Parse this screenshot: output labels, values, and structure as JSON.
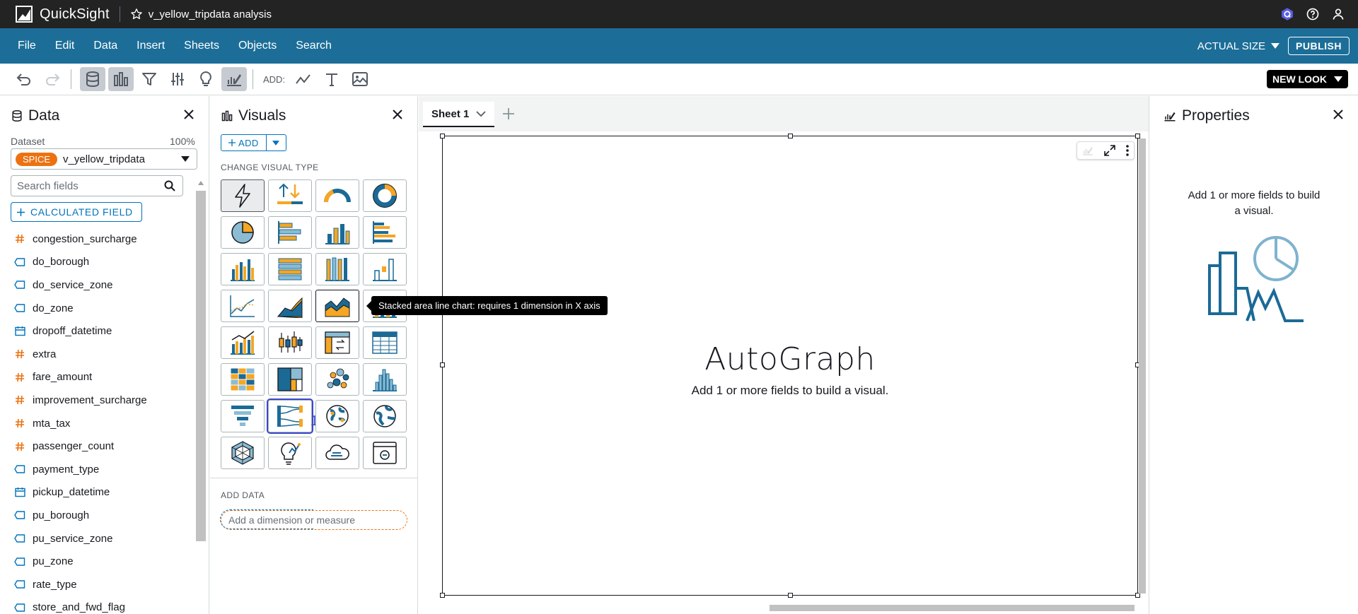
{
  "app": {
    "brand": "QuickSight",
    "analysis_title": "v_yellow_tripdata analysis"
  },
  "menu": {
    "items": [
      "File",
      "Edit",
      "Data",
      "Insert",
      "Sheets",
      "Objects",
      "Search"
    ],
    "zoom": "ACTUAL SIZE",
    "publish": "PUBLISH"
  },
  "toolbar": {
    "add_label": "ADD:",
    "new_look": "NEW LOOK"
  },
  "data_panel": {
    "title": "Data",
    "dataset_label": "Dataset",
    "dataset_pct": "100%",
    "spice": "SPICE",
    "dataset_name": "v_yellow_tripdata",
    "search_placeholder": "Search fields",
    "calc_field": "CALCULATED FIELD",
    "fields": [
      {
        "name": "congestion_surcharge",
        "type": "measure"
      },
      {
        "name": "do_borough",
        "type": "dimension"
      },
      {
        "name": "do_service_zone",
        "type": "dimension"
      },
      {
        "name": "do_zone",
        "type": "dimension"
      },
      {
        "name": "dropoff_datetime",
        "type": "date"
      },
      {
        "name": "extra",
        "type": "measure"
      },
      {
        "name": "fare_amount",
        "type": "measure"
      },
      {
        "name": "improvement_surcharge",
        "type": "measure"
      },
      {
        "name": "mta_tax",
        "type": "measure"
      },
      {
        "name": "passenger_count",
        "type": "measure"
      },
      {
        "name": "payment_type",
        "type": "dimension"
      },
      {
        "name": "pickup_datetime",
        "type": "date"
      },
      {
        "name": "pu_borough",
        "type": "dimension"
      },
      {
        "name": "pu_service_zone",
        "type": "dimension"
      },
      {
        "name": "pu_zone",
        "type": "dimension"
      },
      {
        "name": "rate_type",
        "type": "dimension"
      },
      {
        "name": "store_and_fwd_flag",
        "type": "dimension"
      }
    ]
  },
  "visuals_panel": {
    "title": "Visuals",
    "add": "ADD",
    "change_type_label": "CHANGE VISUAL TYPE",
    "badge": "1",
    "add_data_label": "ADD DATA",
    "drop_placeholder": "Add a dimension or measure"
  },
  "canvas": {
    "sheet_tab": "Sheet 1",
    "visual_title": "AutoGraph",
    "visual_subtitle": "Add 1 or more fields to build a visual."
  },
  "tooltip": "Stacked area line chart: requires 1 dimension in X axis",
  "properties": {
    "title": "Properties",
    "message": "Add 1 or more fields to build a visual."
  },
  "colors": {
    "menubar": "#1c6e98",
    "topbar": "#232323",
    "accent": "#0073bb",
    "orange": "#ec7211",
    "chart_blue": "#1b6a96",
    "chart_orange": "#f5a623"
  }
}
